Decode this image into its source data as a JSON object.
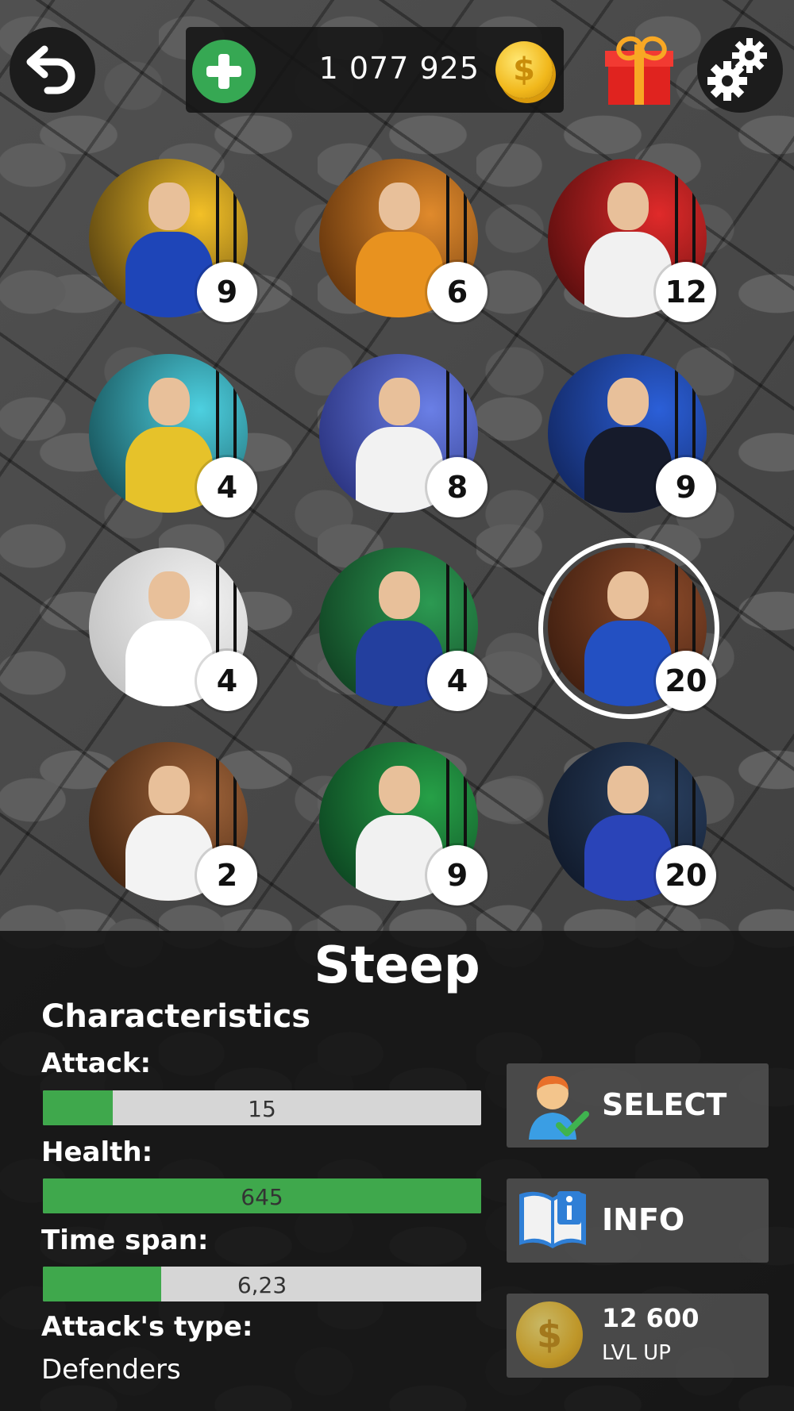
{
  "top_bar": {
    "coins": "1 077 925",
    "coin_symbol": "$"
  },
  "characters": [
    {
      "level": "9",
      "bg": [
        "#f3c027",
        "#3a2a0c"
      ],
      "outfit": "#1e45b8"
    },
    {
      "level": "6",
      "bg": [
        "#e08a2c",
        "#4a2306"
      ],
      "outfit": "#e8921f"
    },
    {
      "level": "12",
      "bg": [
        "#e02a2a",
        "#3c0808"
      ],
      "outfit": "#f1f1f1"
    },
    {
      "level": "4",
      "bg": [
        "#4dd0e0",
        "#0d3b40"
      ],
      "outfit": "#e6c22a"
    },
    {
      "level": "8",
      "bg": [
        "#6a7fe6",
        "#1d236a"
      ],
      "outfit": "#f2f2f2"
    },
    {
      "level": "9",
      "bg": [
        "#2b5fd8",
        "#0d1c4a"
      ],
      "outfit": "#161b2b"
    },
    {
      "level": "4",
      "bg": [
        "#f2f2f2",
        "#b9b9b9"
      ],
      "outfit": "#ffffff"
    },
    {
      "level": "4",
      "bg": [
        "#2c9a52",
        "#0b3019"
      ],
      "outfit": "#233f9e"
    },
    {
      "level": "20",
      "bg": [
        "#8b4a2a",
        "#2f150a"
      ],
      "outfit": "#2350c2"
    },
    {
      "level": "2",
      "bg": [
        "#a0643a",
        "#2e1708"
      ],
      "outfit": "#f3f3f3"
    },
    {
      "level": "9",
      "bg": [
        "#26a047",
        "#08331a"
      ],
      "outfit": "#f1f1f1"
    },
    {
      "level": "20",
      "bg": [
        "#2a4060",
        "#0b1220"
      ],
      "outfit": "#2a44b8"
    }
  ],
  "selected_index": 8,
  "details": {
    "name": "Steep",
    "heading": "Characteristics",
    "attack_label": "Attack:",
    "attack_value": "15",
    "attack_fill": 0.16,
    "health_label": "Health:",
    "health_value": "645",
    "health_fill": 1.0,
    "time_span_label": "Time span:",
    "time_span_value": "6,23",
    "time_span_fill": 0.27,
    "attack_type_label": "Attack's type:",
    "attack_type_value": "Defenders"
  },
  "buttons": {
    "select": "SELECT",
    "info": "INFO",
    "lvl_up_price": "12 600",
    "lvl_up_label": "LVL UP"
  },
  "colors": {
    "accent_green": "#3fa84c",
    "plus_green": "#36a853",
    "gift_red": "#e0231f"
  }
}
